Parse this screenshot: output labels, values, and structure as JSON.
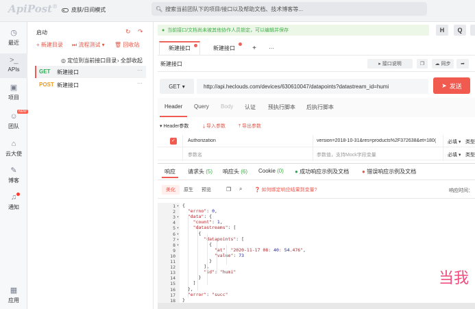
{
  "app": {
    "logo": "ApiPost",
    "logo_mark": "®",
    "theme_toggle": "皮肤/日间模式",
    "search_placeholder": "搜索当前团队下的项目/接口以及帮助文档、技术博客等..."
  },
  "leftnav": {
    "items": [
      {
        "label": "最近",
        "icon": "clock-icon"
      },
      {
        "label": "APIs",
        "icon": "terminal-icon"
      },
      {
        "label": "项目",
        "icon": "project-icon"
      },
      {
        "label": "团队",
        "icon": "team-icon",
        "badge": "NEW"
      },
      {
        "label": "云大使",
        "icon": "graduation-cap-icon"
      },
      {
        "label": "博客",
        "icon": "edit-icon"
      },
      {
        "label": "通知",
        "icon": "bell-icon"
      },
      {
        "label": "应用",
        "icon": "apps-grid-icon"
      }
    ]
  },
  "tree": {
    "start_label": "启动",
    "new_dir": "新建目录",
    "process_test": "流程测试",
    "recycle": "回收站",
    "locate": "定位到当前接口目录",
    "collapse_all": "全部收起",
    "items": [
      {
        "method": "GET",
        "name": "新建接口"
      },
      {
        "method": "POST",
        "name": "新建接口"
      }
    ]
  },
  "notice": "当前接口/文档尚未被其他协作人员锁定，可以编辑并保存",
  "top_right_buttons": [
    "H",
    "Q"
  ],
  "tabs": [
    {
      "label": "新建接口",
      "active": true
    },
    {
      "label": "新建接口",
      "active": false
    }
  ],
  "tab_add": "+",
  "tab_more": "···",
  "api_name": "新建接口",
  "toolbar": {
    "doc_btn": "接口说明",
    "sync_btn": "同步"
  },
  "request": {
    "method": "GET",
    "url": "http://api.heclouds.com/devices/630610047/datapoints?datastream_id=humi",
    "send": "发送"
  },
  "req_tabs": [
    "Header",
    "Query",
    "Body",
    "认证",
    "预执行脚本",
    "后执行脚本"
  ],
  "header_section": {
    "title": "Header参数",
    "import": "导入参数",
    "export": "导出参数"
  },
  "header_rows": [
    {
      "key": "Authorization",
      "value": "version=2018-10-31&res=products%2F372638&et=180(",
      "required": "必填",
      "type": "类型"
    },
    {
      "key": "参数名",
      "value": "参数值，支持Mock字段变量",
      "required": "必填",
      "type": "类型"
    }
  ],
  "resp_tabs": [
    {
      "label": "响应",
      "count": ""
    },
    {
      "label": "请求头",
      "count": "(5)"
    },
    {
      "label": "响应头",
      "count": "(6)"
    },
    {
      "label": "Cookie",
      "count": "(0)"
    },
    {
      "label": "成功响应示例及文档",
      "count": ""
    },
    {
      "label": "错误响应示例及文档",
      "count": ""
    }
  ],
  "view_pills": [
    "美化",
    "原生",
    "预览"
  ],
  "bind_hint": "如何绑定响应结果到变量?",
  "resp_time_label": "响应时间：",
  "code_lines": [
    "{",
    "  \"errno\": 0,",
    "  \"data\": {",
    "    \"count\": 1,",
    "    \"datastreams\": [",
    "      {",
    "        \"datapoints\": [",
    "          {",
    "            \"at\": \"2020-11-17 08:40:54.476\",",
    "            \"value\": 73",
    "          }",
    "        ],",
    "        \"id\": \"humi\"",
    "      }",
    "    ]",
    "  },",
    "  \"error\": \"succ\"",
    "}"
  ],
  "overlay_text": "当我",
  "colors": {
    "accent": "#f05a4f",
    "green": "#3fae49",
    "orange": "#f09a20"
  }
}
